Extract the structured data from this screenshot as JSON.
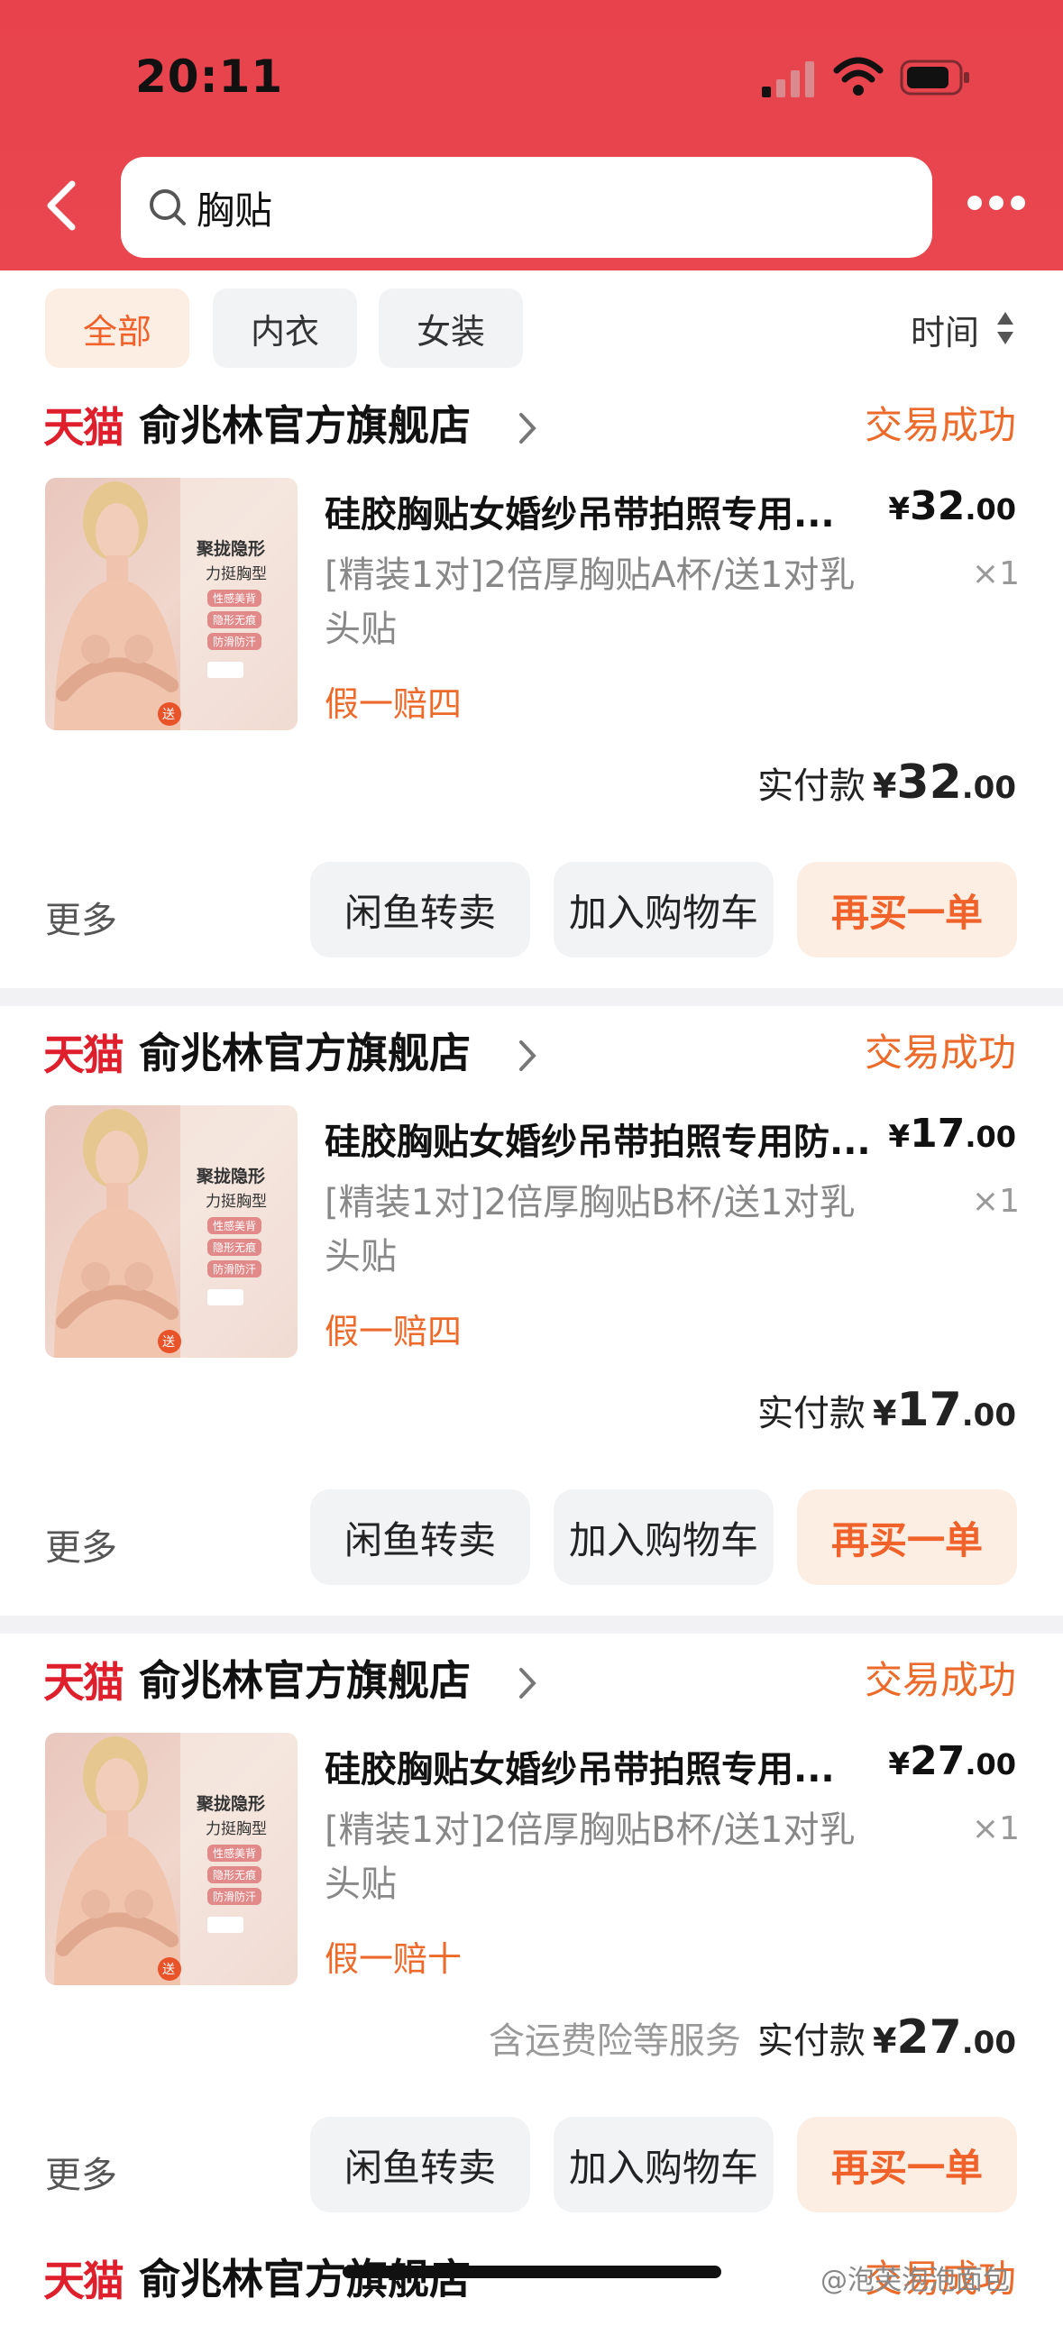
{
  "status_bar": {
    "time": "20:11"
  },
  "search": {
    "query": "胸贴"
  },
  "filters": {
    "chips": [
      "全部",
      "内衣",
      "女装"
    ],
    "active_index": 0,
    "sort_label": "时间"
  },
  "colors": {
    "header": "#e8434d",
    "accent": "#f0622a",
    "tmall": "#e01f2d"
  },
  "orders": [
    {
      "tmall_badge": "天猫",
      "shop": "俞兆林官方旗舰店",
      "status": "交易成功",
      "thumb_text": {
        "l1": "聚拢隐形",
        "l2": "力挺胸型",
        "b1": "性感美背",
        "b2": "隐形无痕",
        "b3": "防滑防汗",
        "gift": "送"
      },
      "title": "硅胶胸贴女婚纱吊带拍照专用...",
      "price_symbol": "¥",
      "price_int": "32",
      "price_dec": ".00",
      "spec": "[精装1对]2倍厚胸贴A杯/送1对乳头贴",
      "qty": "×1",
      "guarantee": "假一赔四",
      "service_text": "",
      "paid_label": "实付款",
      "paid_symbol": "¥",
      "paid_int": "32",
      "paid_dec": ".00",
      "more": "更多",
      "btn1": "闲鱼转卖",
      "btn2": "加入购物车",
      "btn3": "再买一单"
    },
    {
      "tmall_badge": "天猫",
      "shop": "俞兆林官方旗舰店",
      "status": "交易成功",
      "thumb_text": {
        "l1": "聚拢隐形",
        "l2": "力挺胸型",
        "b1": "性感美背",
        "b2": "隐形无痕",
        "b3": "防滑防汗",
        "gift": "送"
      },
      "title": "硅胶胸贴女婚纱吊带拍照专用防...",
      "price_symbol": "¥",
      "price_int": "17",
      "price_dec": ".00",
      "spec": "[精装1对]2倍厚胸贴B杯/送1对乳头贴",
      "qty": "×1",
      "guarantee": "假一赔四",
      "service_text": "",
      "paid_label": "实付款",
      "paid_symbol": "¥",
      "paid_int": "17",
      "paid_dec": ".00",
      "more": "更多",
      "btn1": "闲鱼转卖",
      "btn2": "加入购物车",
      "btn3": "再买一单"
    },
    {
      "tmall_badge": "天猫",
      "shop": "俞兆林官方旗舰店",
      "status": "交易成功",
      "thumb_text": {
        "l1": "聚拢隐形",
        "l2": "力挺胸型",
        "b1": "性感美背",
        "b2": "隐形无痕",
        "b3": "防滑防汗",
        "gift": "送"
      },
      "title": "硅胶胸贴女婚纱吊带拍照专用...",
      "price_symbol": "¥",
      "price_int": "27",
      "price_dec": ".00",
      "spec": "[精装1对]2倍厚胸贴B杯/送1对乳头贴",
      "qty": "×1",
      "guarantee": "假一赔十",
      "service_text": "含运费险等服务",
      "paid_label": "实付款",
      "paid_symbol": "¥",
      "paid_int": "27",
      "paid_dec": ".00",
      "more": "更多",
      "btn1": "闲鱼转卖",
      "btn2": "加入购物车",
      "btn3": "再买一单"
    }
  ],
  "watermark": "@泡芙泡泡面包"
}
